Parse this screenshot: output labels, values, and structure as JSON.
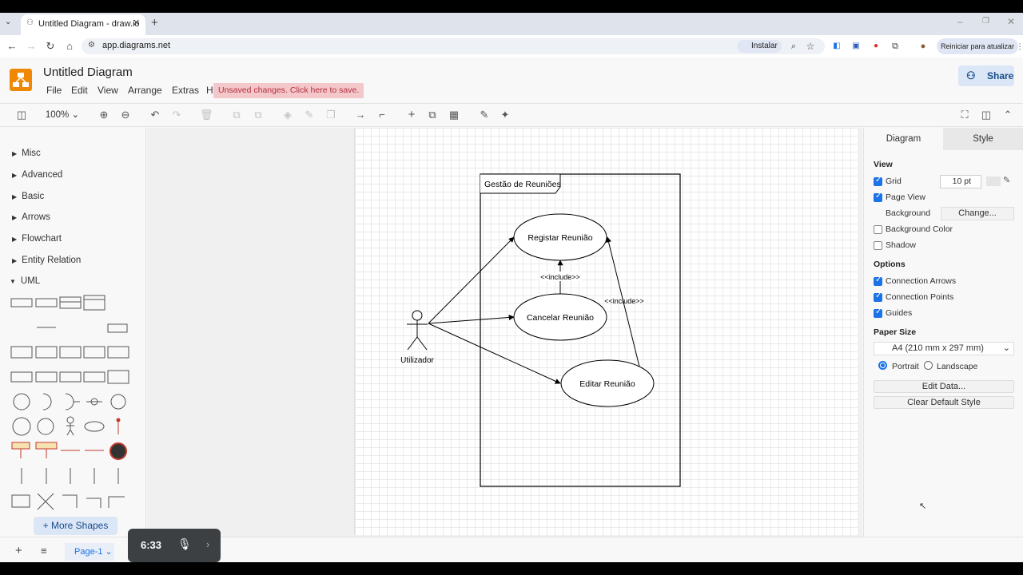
{
  "browser": {
    "tab_title": "Untitled Diagram - draw.io",
    "url": "app.diagrams.net",
    "install_label": "Instalar",
    "update_label": "Reiniciar para atualizar"
  },
  "app": {
    "doc_title": "Untitled Diagram",
    "menus": [
      "File",
      "Edit",
      "View",
      "Arrange",
      "Extras",
      "Help"
    ],
    "unsaved_notice": "Unsaved changes. Click here to save.",
    "share_label": "Share",
    "zoom": "100%"
  },
  "sidebar": {
    "categories": [
      "Misc",
      "Advanced",
      "Basic",
      "Arrows",
      "Flowchart",
      "Entity Relation",
      "UML"
    ],
    "expanded": "UML",
    "more_shapes_label": "More Shapes"
  },
  "diagram": {
    "system_title": "Gestão de Reuniões",
    "actor": "Utilizador",
    "use_cases": [
      "Registar Reunião",
      "Cancelar Reunião",
      "Editar Reunião"
    ],
    "include_label_1": "<<include>>",
    "include_label_2": "<<include>>"
  },
  "format_panel": {
    "tab_diagram": "Diagram",
    "tab_style": "Style",
    "view_heading": "View",
    "grid_label": "Grid",
    "grid_size": "10 pt",
    "page_view_label": "Page View",
    "background_label": "Background",
    "change_label": "Change...",
    "background_color_label": "Background Color",
    "shadow_label": "Shadow",
    "options_heading": "Options",
    "connection_arrows_label": "Connection Arrows",
    "connection_points_label": "Connection Points",
    "guides_label": "Guides",
    "paper_size_heading": "Paper Size",
    "paper_size_value": "A4 (210 mm x 297 mm)",
    "portrait_label": "Portrait",
    "landscape_label": "Landscape",
    "edit_data_label": "Edit Data...",
    "clear_style_label": "Clear Default Style",
    "grid_on": true,
    "page_view_on": true,
    "background_color_on": false,
    "shadow_on": false,
    "connection_arrows_on": true,
    "connection_points_on": true,
    "guides_on": true,
    "orientation": "Portrait"
  },
  "footer": {
    "page_tab": "Page-1",
    "recorder_time": "6:33"
  },
  "colors": {
    "accent": "#1a73e8",
    "logo": "#f08705",
    "unsaved_bg": "#f4c7cb",
    "unsaved_text": "#b0303c"
  }
}
